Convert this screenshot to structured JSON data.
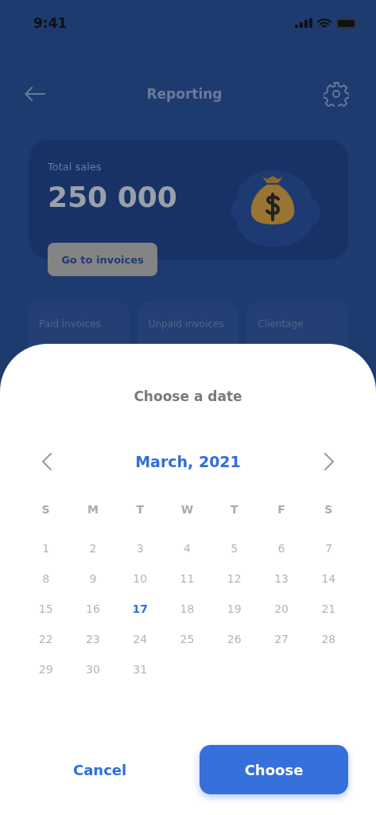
{
  "status_bar": {
    "time": "9:41"
  },
  "header": {
    "title": "Reporting"
  },
  "sales_card": {
    "label": "Total sales",
    "value": "250 000",
    "button": "Go to invoices"
  },
  "stat_cards": [
    {
      "label": "Paid invoices"
    },
    {
      "label": "Unpaid invoices"
    },
    {
      "label": "Clientage"
    }
  ],
  "date_sheet": {
    "title": "Choose a date",
    "month": "March, 2021",
    "weekdays": [
      "S",
      "M",
      "T",
      "W",
      "T",
      "F",
      "S"
    ],
    "days": [
      {
        "label": "1",
        "selected": false
      },
      {
        "label": "2",
        "selected": false
      },
      {
        "label": "3",
        "selected": false
      },
      {
        "label": "4",
        "selected": false
      },
      {
        "label": "5",
        "selected": false
      },
      {
        "label": "6",
        "selected": false
      },
      {
        "label": "7",
        "selected": false
      },
      {
        "label": "8",
        "selected": false
      },
      {
        "label": "9",
        "selected": false
      },
      {
        "label": "10",
        "selected": false
      },
      {
        "label": "11",
        "selected": false
      },
      {
        "label": "12",
        "selected": false
      },
      {
        "label": "13",
        "selected": false
      },
      {
        "label": "14",
        "selected": false
      },
      {
        "label": "15",
        "selected": false
      },
      {
        "label": "16",
        "selected": false
      },
      {
        "label": "17",
        "selected": true
      },
      {
        "label": "18",
        "selected": false
      },
      {
        "label": "19",
        "selected": false
      },
      {
        "label": "20",
        "selected": false
      },
      {
        "label": "21",
        "selected": false
      },
      {
        "label": "22",
        "selected": false
      },
      {
        "label": "23",
        "selected": false
      },
      {
        "label": "24",
        "selected": false
      },
      {
        "label": "25",
        "selected": false
      },
      {
        "label": "26",
        "selected": false
      },
      {
        "label": "27",
        "selected": false
      },
      {
        "label": "28",
        "selected": false
      },
      {
        "label": "29",
        "selected": false
      },
      {
        "label": "30",
        "selected": false
      },
      {
        "label": "31",
        "selected": false
      }
    ],
    "buttons": [
      {
        "label": "Cancel",
        "kind": "text"
      },
      {
        "label": "Choose",
        "kind": "primary"
      }
    ]
  }
}
